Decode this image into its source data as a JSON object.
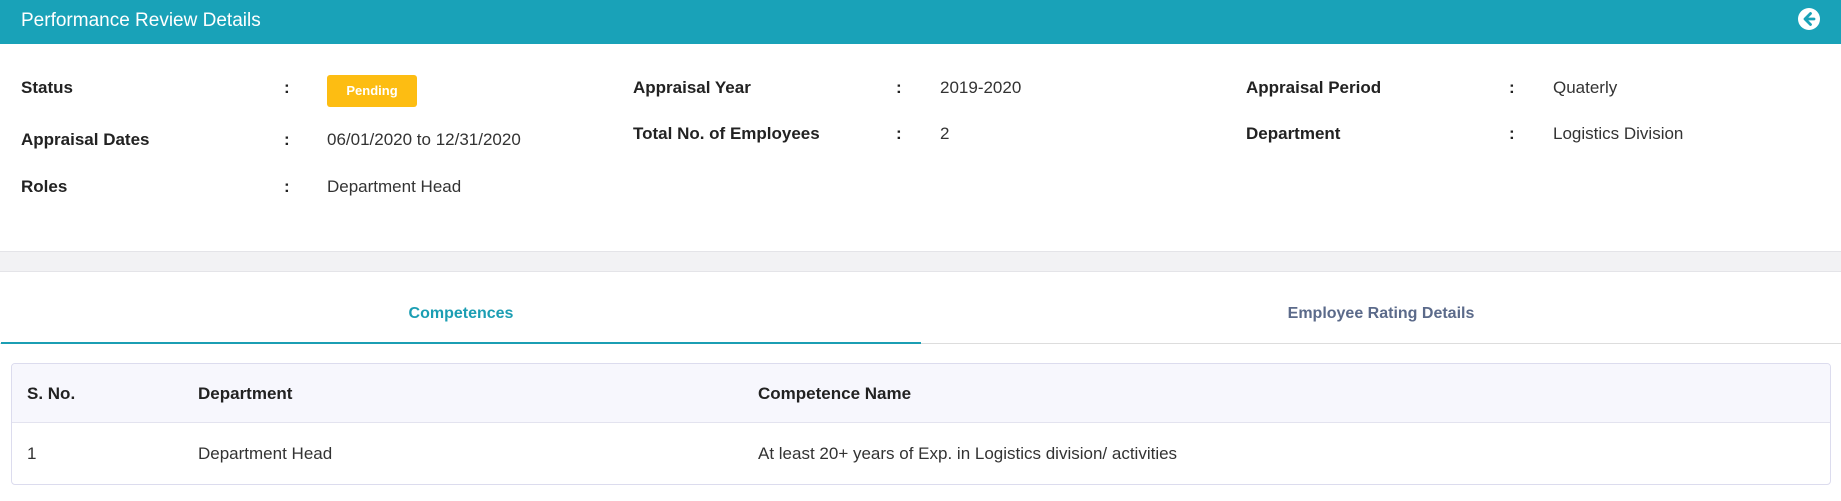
{
  "header": {
    "title": "Performance Review Details"
  },
  "details": {
    "status": {
      "label": "Status",
      "value": "Pending"
    },
    "appraisal_dates": {
      "label": "Appraisal Dates",
      "value": "06/01/2020 to 12/31/2020"
    },
    "roles": {
      "label": "Roles",
      "value": "Department Head"
    },
    "appraisal_year": {
      "label": "Appraisal Year",
      "value": "2019-2020"
    },
    "total_employees": {
      "label": "Total No. of Employees",
      "value": "2"
    },
    "appraisal_period": {
      "label": "Appraisal Period",
      "value": "Quaterly"
    },
    "department": {
      "label": "Department",
      "value": "Logistics Division"
    },
    "separator": ":"
  },
  "tabs": [
    {
      "label": "Competences",
      "active": true
    },
    {
      "label": "Employee Rating Details",
      "active": false
    }
  ],
  "table": {
    "columns": [
      "S. No.",
      "Department",
      "Competence Name"
    ],
    "rows": [
      [
        "1",
        "Department Head",
        "At least 20+ years of Exp. in Logistics division/ activities"
      ]
    ]
  },
  "colors": {
    "header": "#19a2b8",
    "status_badge": "#fdbd12",
    "active_tab": "#1b9eb3",
    "inactive_tab": "#5b6a8a"
  },
  "icons": {
    "back": "arrow-circle-left-icon"
  }
}
